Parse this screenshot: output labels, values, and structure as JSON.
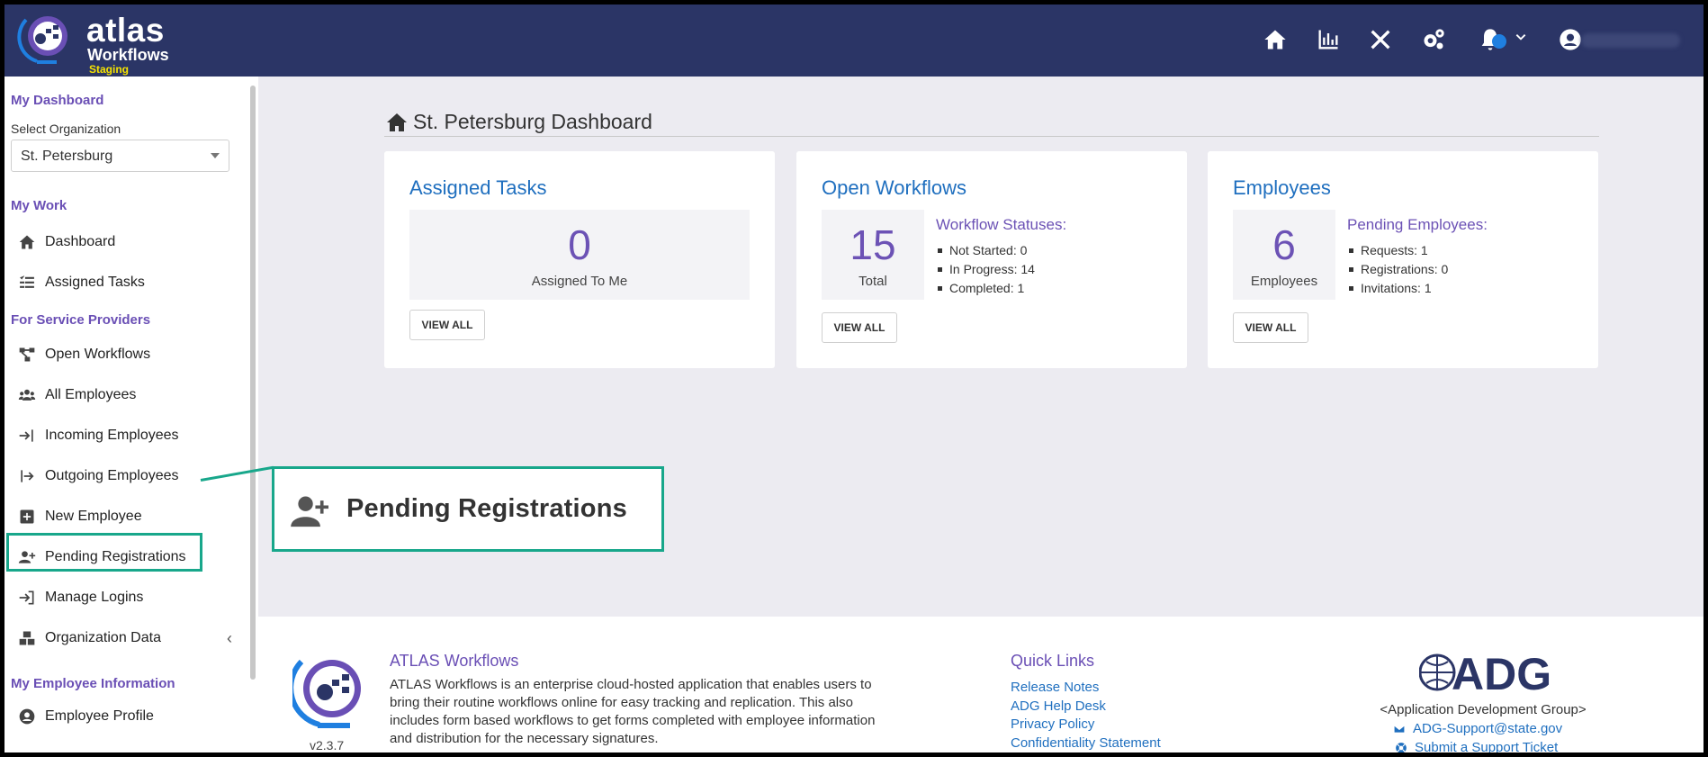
{
  "header": {
    "logo_main": "atlas",
    "logo_sub": "Workflows",
    "logo_env": "Staging",
    "icons": [
      "home-icon",
      "chart-icon",
      "tools-icon",
      "cogs-icon",
      "bell-icon",
      "chevron-down-icon",
      "user-circle-icon"
    ]
  },
  "sidebar": {
    "my_dashboard": "My Dashboard",
    "select_org_label": "Select Organization",
    "selected_org": "St. Petersburg",
    "my_work": "My Work",
    "dashboard": "Dashboard",
    "assigned_tasks": "Assigned Tasks",
    "for_service_providers": "For Service Providers",
    "open_workflows": "Open Workflows",
    "all_employees": "All Employees",
    "incoming_employees": "Incoming Employees",
    "outgoing_employees": "Outgoing Employees",
    "new_employee": "New Employee",
    "pending_registrations": "Pending Registrations",
    "manage_logins": "Manage Logins",
    "organization_data": "Organization Data",
    "org_data_chevron": "‹",
    "my_employee_information": "My Employee Information",
    "employee_profile": "Employee Profile"
  },
  "callout": {
    "label": "Pending Registrations"
  },
  "main": {
    "title": "St. Petersburg Dashboard",
    "assigned": {
      "title": "Assigned Tasks",
      "count": "0",
      "count_label": "Assigned To Me",
      "button": "VIEW ALL"
    },
    "workflows": {
      "title": "Open Workflows",
      "count": "15",
      "count_label": "Total",
      "statuses_title": "Workflow Statuses:",
      "statuses": [
        "Not Started: 0",
        "In Progress: 14",
        "Completed: 1"
      ],
      "button": "VIEW ALL"
    },
    "employees": {
      "title": "Employees",
      "count": "6",
      "count_label": "Employees",
      "pending_title": "Pending Employees:",
      "pending": [
        "Requests: 1",
        "Registrations: 0",
        "Invitations: 1"
      ],
      "button": "VIEW ALL"
    }
  },
  "footer": {
    "version": "v2.3.7",
    "title": "ATLAS Workflows",
    "description": "ATLAS Workflows is an enterprise cloud-hosted application that enables users to bring their routine workflows online for easy tracking and replication. This also includes form based workflows to get forms completed with employee information and distribution for the necessary signatures.",
    "quick_links_title": "Quick Links",
    "quick_links": [
      "Release Notes",
      "ADG Help Desk",
      "Privacy Policy",
      "Confidentiality Statement"
    ],
    "adg_logo": "ADG",
    "adg_name": "<Application Development Group>",
    "adg_email": "ADG-Support@state.gov",
    "adg_ticket": "Submit a Support Ticket"
  },
  "colors": {
    "topbar": "#2b3566",
    "accent_purple": "#6a4fb5",
    "link_blue": "#1f6fbf",
    "highlight_green": "#18a78b",
    "staging_yellow": "#f6e300"
  }
}
